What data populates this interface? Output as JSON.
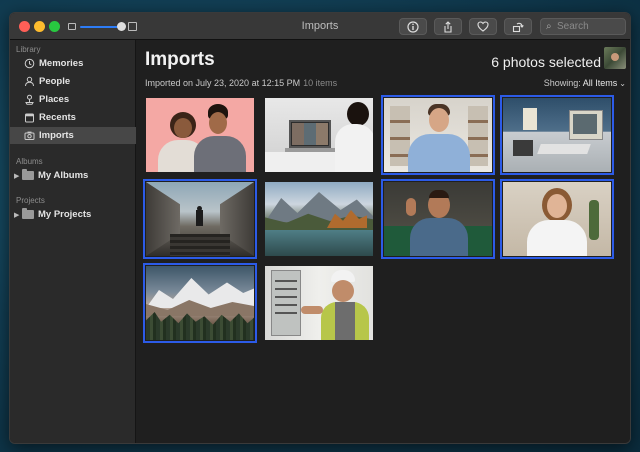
{
  "window": {
    "title": "Imports",
    "toolbar": {
      "info_icon": "info-icon",
      "share_icon": "share-icon",
      "favorite_icon": "heart-icon",
      "rotate_icon": "rotate-icon",
      "search_placeholder": "Search"
    }
  },
  "sidebar": {
    "library_label": "Library",
    "library_items": [
      {
        "label": "Memories",
        "icon": "memories-icon"
      },
      {
        "label": "People",
        "icon": "people-icon"
      },
      {
        "label": "Places",
        "icon": "places-icon"
      },
      {
        "label": "Recents",
        "icon": "recents-icon"
      },
      {
        "label": "Imports",
        "icon": "imports-icon",
        "active": true
      }
    ],
    "albums_label": "Albums",
    "albums_item": "My Albums",
    "projects_label": "Projects",
    "projects_item": "My Projects"
  },
  "main": {
    "title": "Imports",
    "selection_status": "6 photos selected",
    "subtitle": "Imported on July 23, 2020 at 12:15 PM",
    "item_count": "10 items",
    "showing_label": "Showing:",
    "showing_value": "All Items",
    "selection_color": "#2c5be8",
    "photos": [
      {
        "subject": "two smiling people on pink background",
        "selected": false
      },
      {
        "subject": "person on video call with laptop",
        "selected": false
      },
      {
        "subject": "smiling man in front of bookshelf",
        "selected": true
      },
      {
        "subject": "retro desk with old computer",
        "selected": true
      },
      {
        "subject": "person at end of stairway corridor",
        "selected": true
      },
      {
        "subject": "mountain lake landscape",
        "selected": false
      },
      {
        "subject": "man waving on green sofa",
        "selected": true
      },
      {
        "subject": "smiling woman in bright room",
        "selected": true
      },
      {
        "subject": "snowy mountains above forest",
        "selected": true
      },
      {
        "subject": "worker in hard hat at electrical panel",
        "selected": false
      }
    ]
  }
}
